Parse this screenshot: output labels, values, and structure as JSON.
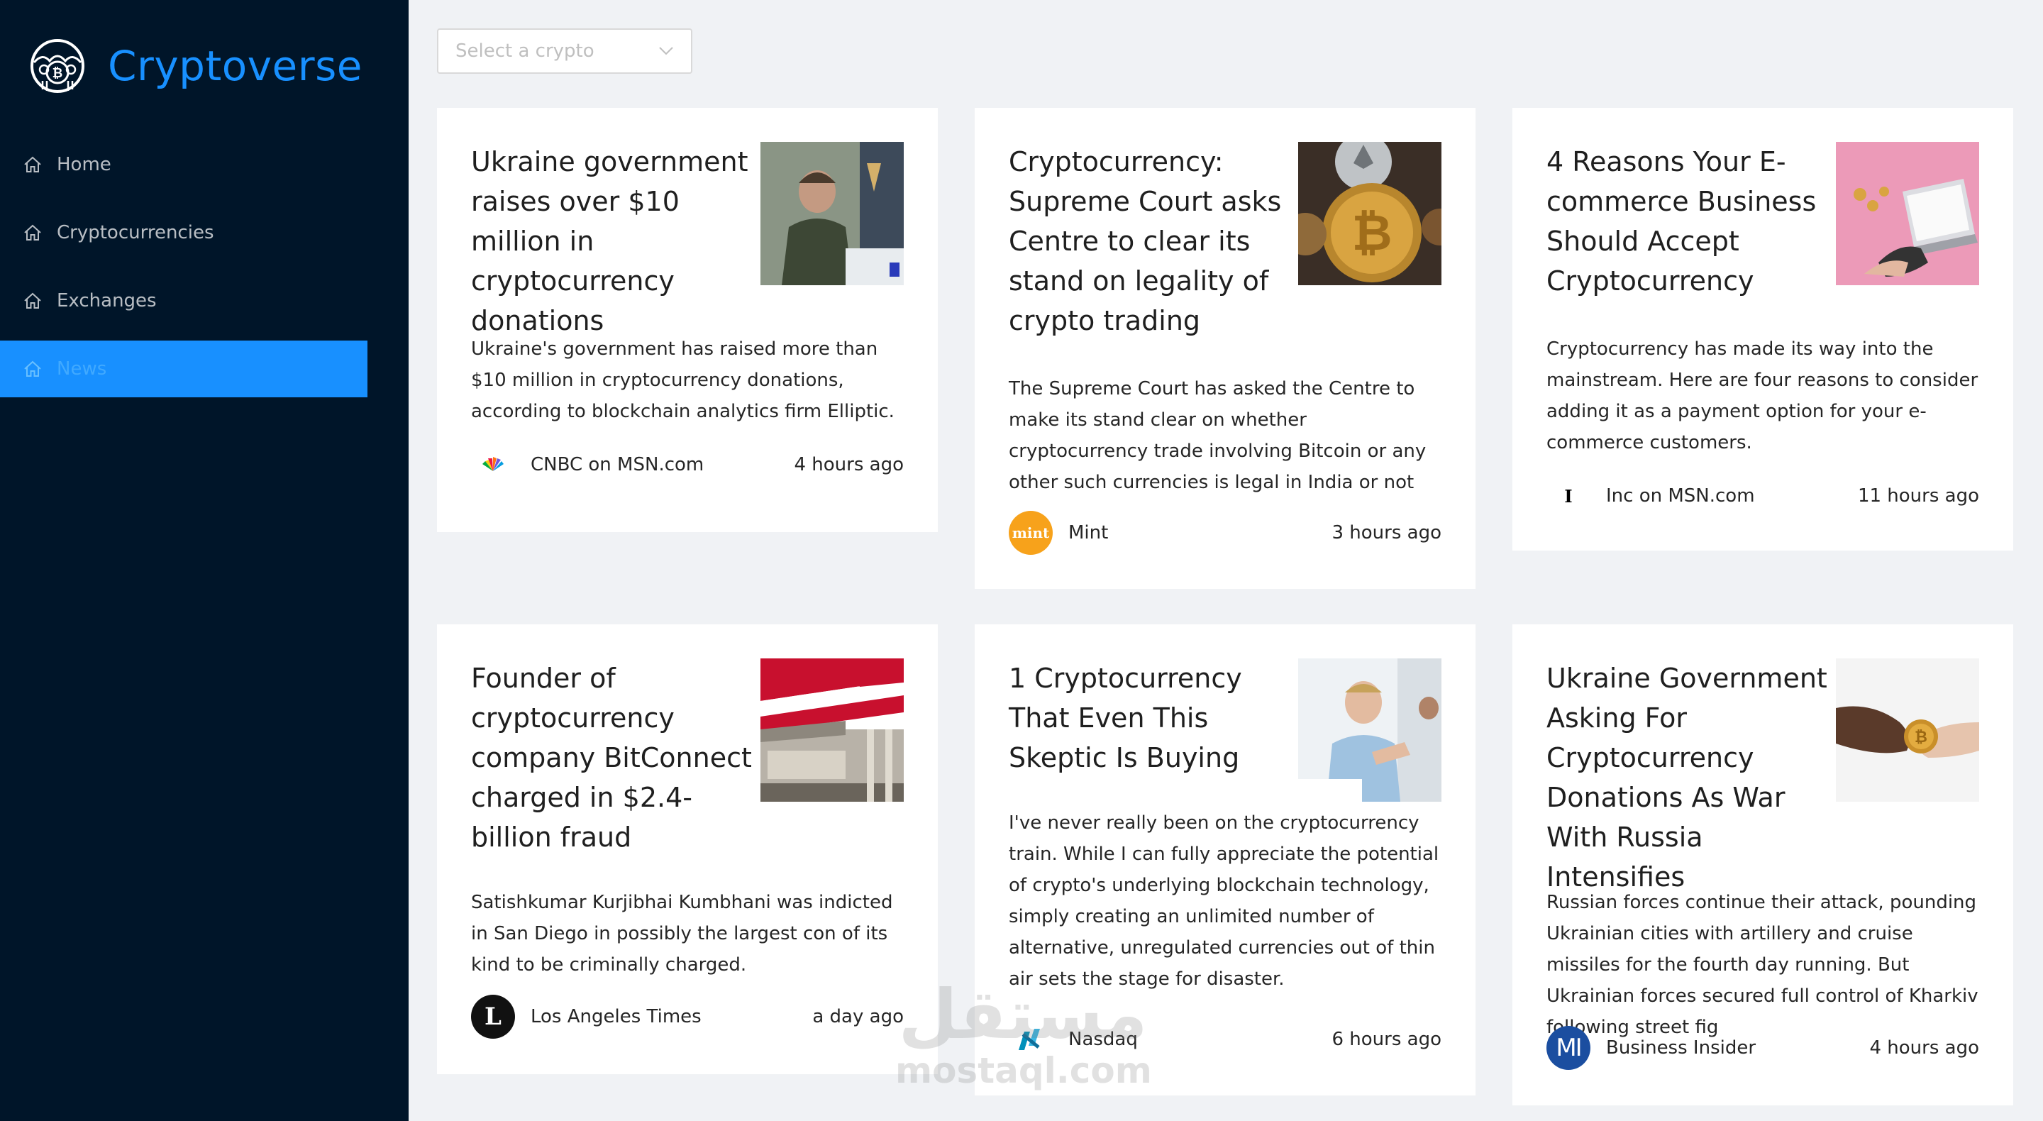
{
  "app": {
    "title": "Cryptoverse"
  },
  "menu": {
    "items": [
      {
        "label": "Home"
      },
      {
        "label": "Cryptocurrencies"
      },
      {
        "label": "Exchanges"
      },
      {
        "label": "News"
      }
    ],
    "active": "News"
  },
  "search": {
    "placeholder": "Select a crypto"
  },
  "news": [
    {
      "title": "Ukraine government raises over $10 million in cryptocurrency donations",
      "description": "Ukraine's government has raised more than $10 million in cryptocurrency donations, according to blockchain analytics firm Elliptic.",
      "provider": "CNBC on MSN.com",
      "time": "4 hours ago",
      "provider_icon": "nbc-peacock-icon",
      "image": "president-at-podium-photo"
    },
    {
      "title": "Cryptocurrency: Supreme Court asks Centre to clear its stand on legality of crypto trading",
      "description": "The Supreme Court has asked the Centre to make its stand clear on whether cryptocurrency trade involving Bitcoin or any other such currencies is legal in India or not",
      "provider": "Mint",
      "time": "3 hours ago",
      "provider_icon": "mint-logo-icon",
      "provider_logo_text": "mint",
      "image": "bitcoin-coins-photo"
    },
    {
      "title": "4 Reasons Your E-commerce Business Should Accept Cryptocurrency",
      "description": "Cryptocurrency has made its way into the mainstream. Here are four reasons to consider adding it as a payment option for your e-commerce customers.",
      "provider": "Inc on MSN.com",
      "time": "11 hours ago",
      "provider_icon": "inc-logo-icon",
      "provider_logo_text": "I",
      "image": "laptop-coins-pink-photo"
    },
    {
      "title": "Founder of cryptocurrency company BitConnect charged in $2.4-billion fraud",
      "description": "Satishkumar Kurjibhai Kumbhani was indicted in San Diego in possibly the largest con of its kind to be criminally charged.",
      "provider": "Los Angeles Times",
      "time": "a day ago",
      "provider_icon": "la-times-logo-icon",
      "provider_logo_text": "L",
      "image": "stock-exchange-flag-photo"
    },
    {
      "title": "1 Cryptocurrency That Even This Skeptic Is Buying",
      "description": "I've never really been on the cryptocurrency train. While I can fully appreciate the potential of crypto's underlying blockchain technology, simply creating an unlimited number of alternative, unregulated currencies out of thin air sets the stage for disaster.",
      "provider": "Nasdaq",
      "time": "6 hours ago",
      "provider_icon": "nasdaq-logo-icon",
      "image": "man-skeptical-office-photo"
    },
    {
      "title": "Ukraine Government Asking For Cryptocurrency Donations As War With Russia Intensifies",
      "description": "Russian forces continue their attack, pounding Ukrainian cities with artillery and cruise missiles for the fourth day running. But Ukrainian forces secured full control of Kharkiv following street fig",
      "provider": "Business Insider",
      "time": "4 hours ago",
      "provider_icon": "business-insider-logo-icon",
      "provider_logo_text": "MI",
      "image": "hands-bitcoin-exchange-photo"
    }
  ],
  "watermark": {
    "arabic": "مستقل",
    "latin": "mostaql.com"
  },
  "colors": {
    "sidebar_bg": "#001529",
    "accent": "#1890ff",
    "page_bg": "#f0f2f5",
    "card_bg": "#ffffff",
    "mint_orange": "#f7a21b",
    "bi_blue": "#1b4ea0"
  }
}
